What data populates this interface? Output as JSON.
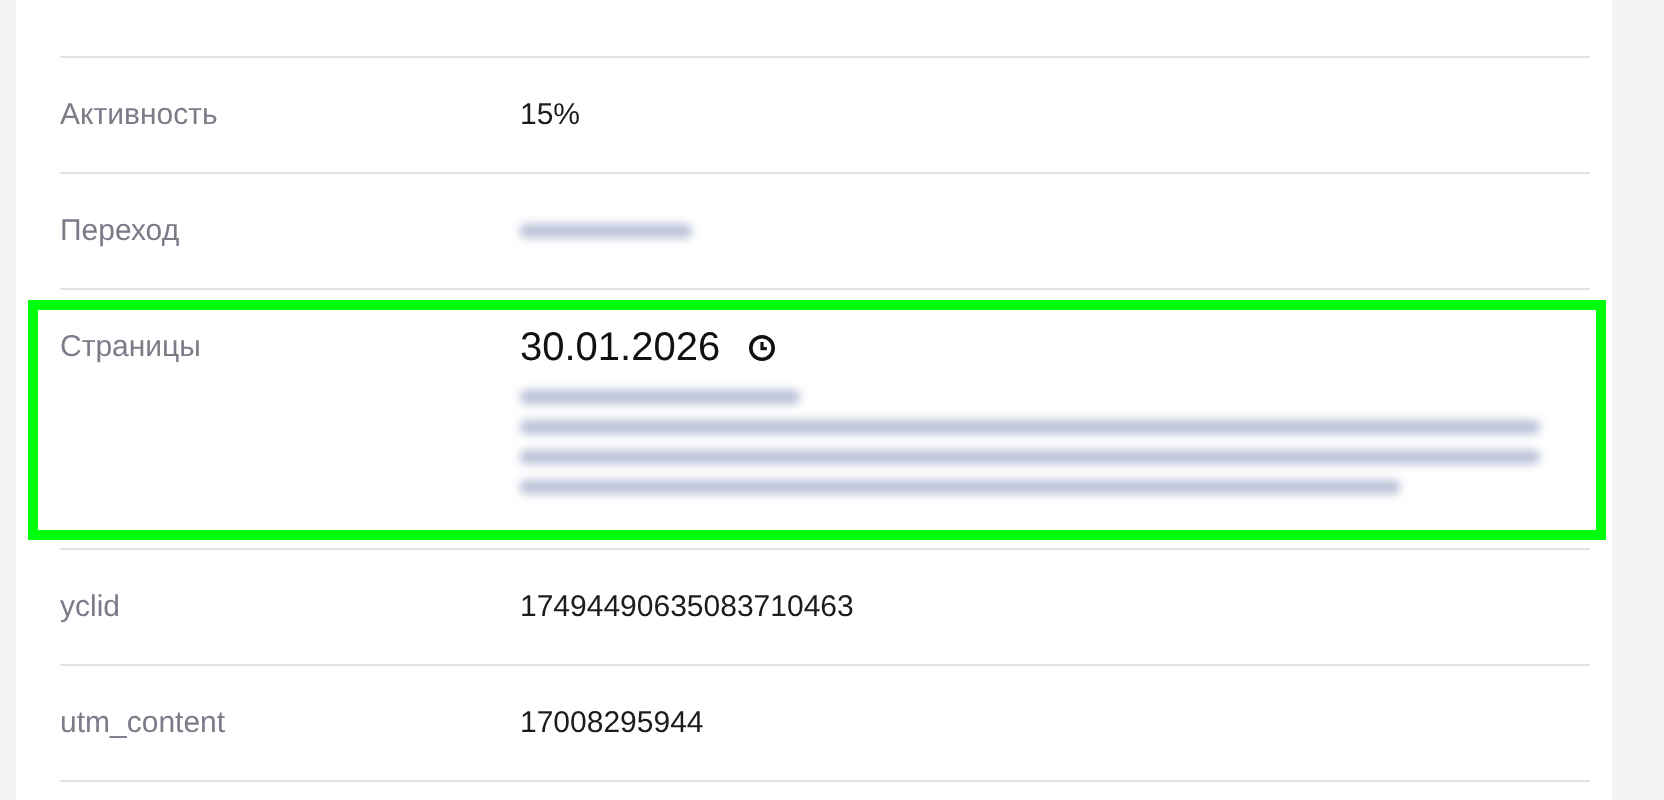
{
  "rows": [
    {
      "label": "Активность",
      "kind": "text",
      "value": "15%",
      "highlighted": false
    },
    {
      "label": "Переход",
      "kind": "blurred",
      "highlighted": false
    },
    {
      "label": "Страницы",
      "kind": "pages",
      "date": "30.01.2026",
      "highlighted": true
    },
    {
      "label": "yclid",
      "kind": "text",
      "value": "17494490635083710463",
      "highlighted": false
    },
    {
      "label": "utm_content",
      "kind": "text",
      "value": "17008295944",
      "highlighted": false
    }
  ]
}
